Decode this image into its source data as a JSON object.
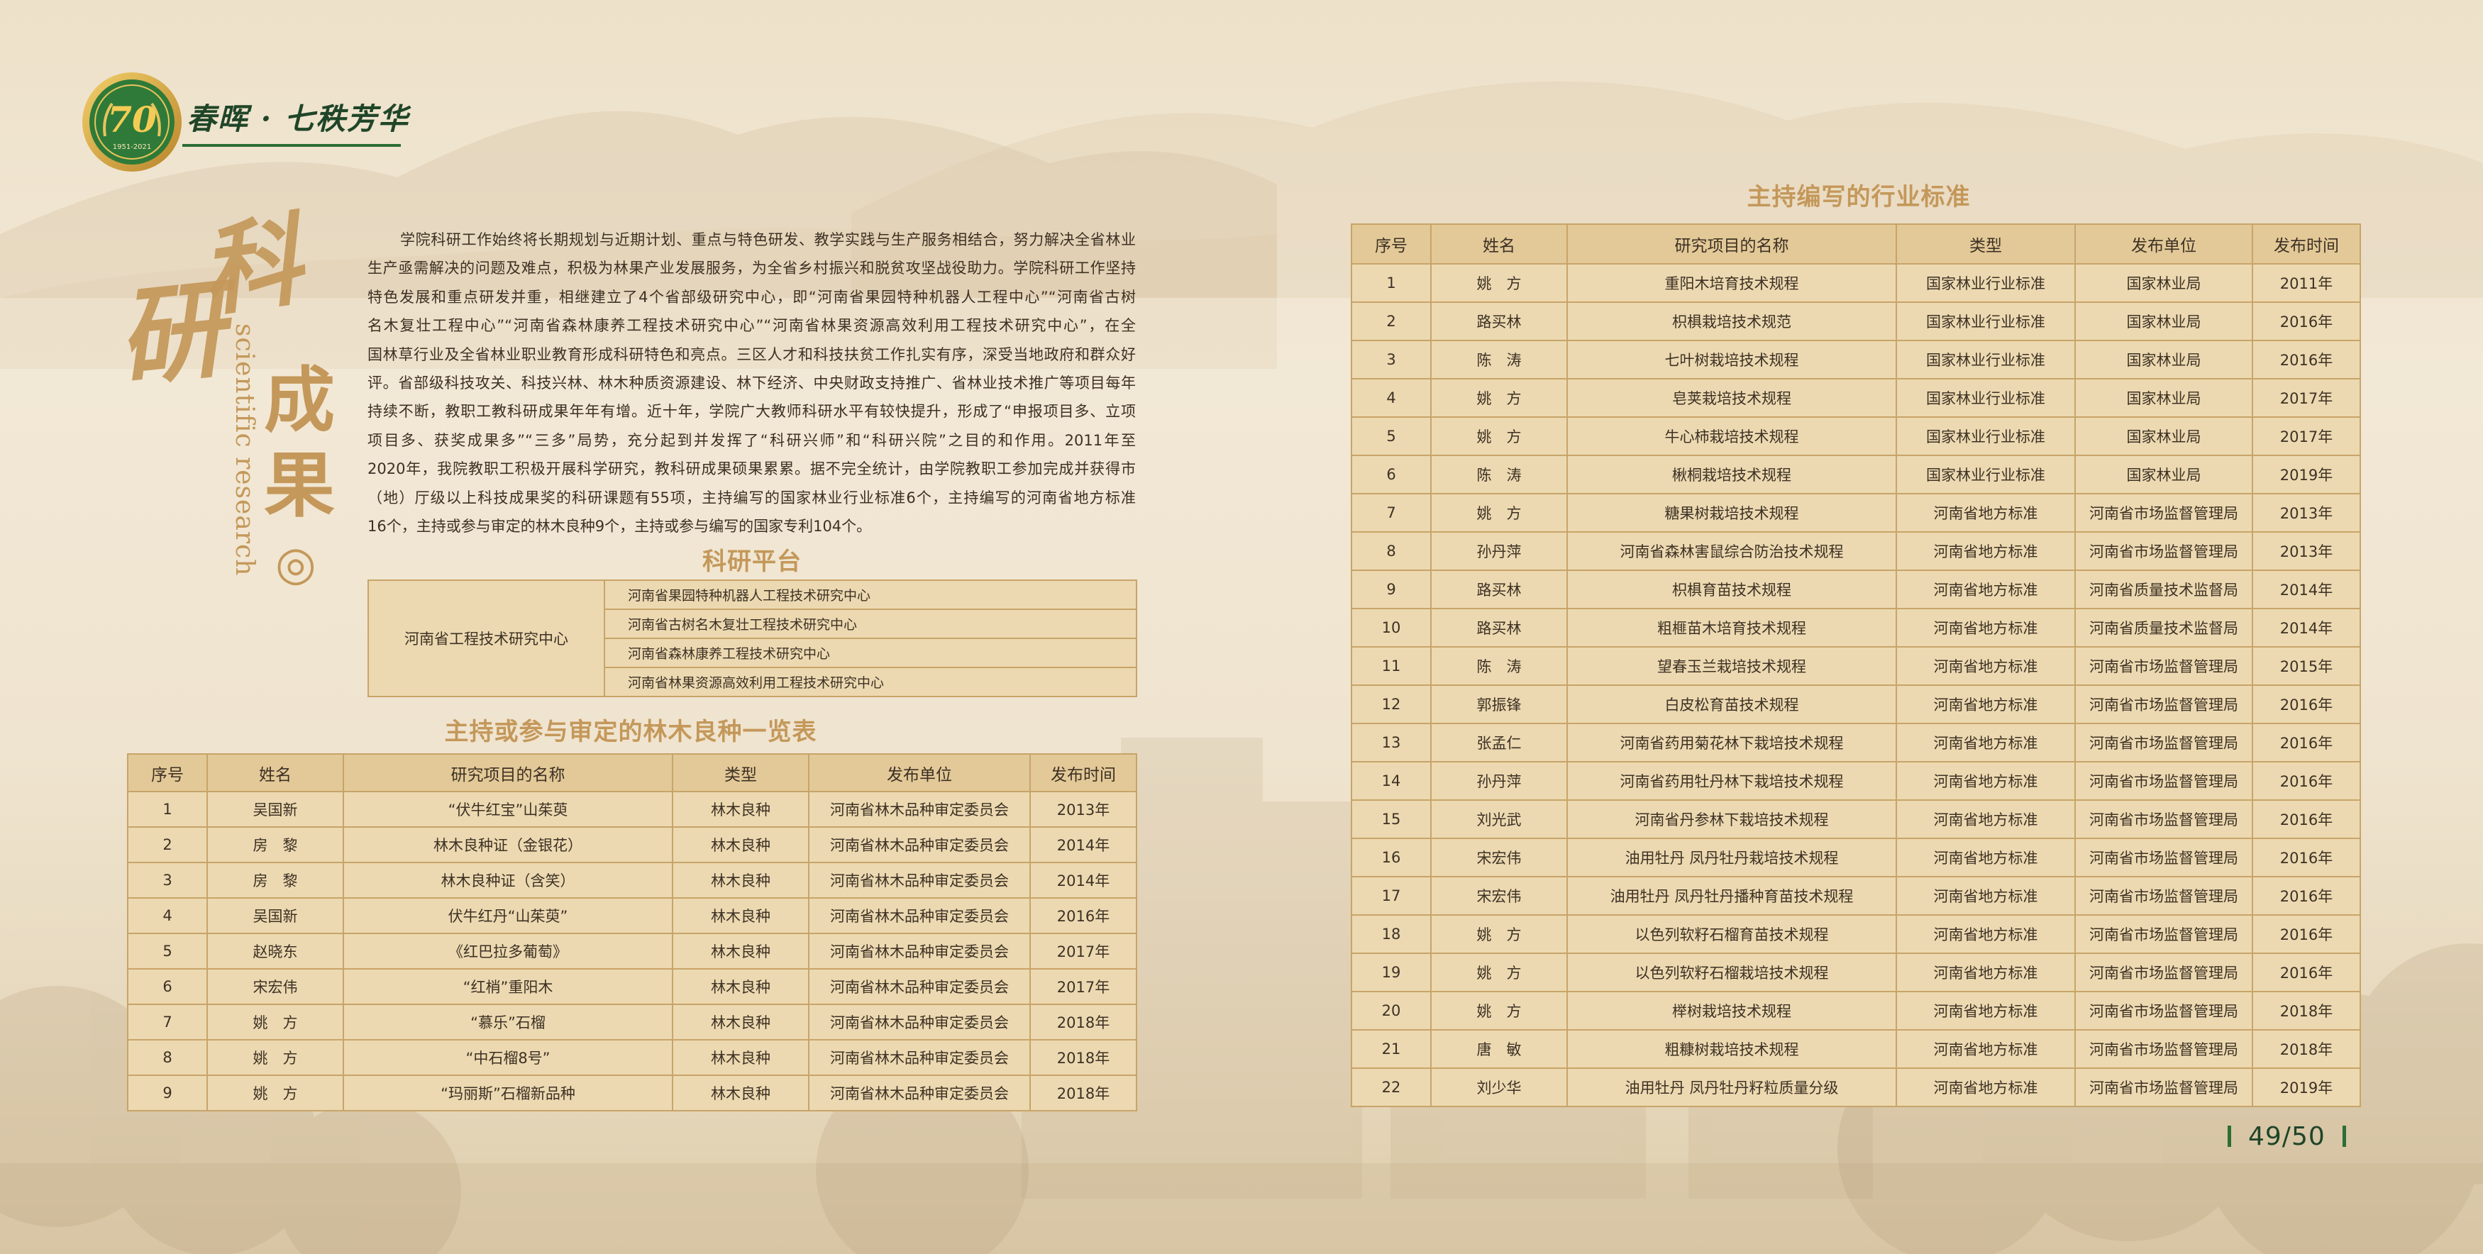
{
  "header": {
    "logo_number": "70",
    "logo_years": "1951-2021",
    "title": "春晖 · 七秩芳华"
  },
  "section": {
    "chars": [
      "科",
      "研",
      "成",
      "果"
    ],
    "subtitle": "scientific research",
    "mark": "◎"
  },
  "intro": {
    "lines": [
      "学院科研工作始终将长期规划与近期计划、重点与特色研发、教学实践与生产服务相结合，努力解决全省林业",
      "生产亟需解决的问题及难点，积极为林果产业发展服务，为全省乡村振兴和脱贫攻坚战役助力。学院科研工作坚持",
      "特色发展和重点研发并重，相继建立了4个省部级研究中心，即“河南省果园特种机器人工程中心”“河南省古树",
      "名木复壮工程中心”“河南省森林康养工程技术研究中心”“河南省林果资源高效利用工程技术研究中心”，在全",
      "国林草行业及全省林业职业教育形成科研特色和亮点。三区人才和科技扶贫工作扎实有序，深受当地政府和群众好",
      "评。省部级科技攻关、科技兴林、林木种质资源建设、林下经济、中央财政支持推广、省林业技术推广等项目每年",
      "持续不断，教职工教科研成果年年有增。近十年，学院广大教师科研水平有较快提升，形成了“申报项目多、立项",
      "项目多、获奖成果多”“三多”局势，充分起到并发挥了“科研兴师”和“科研兴院”之目的和作用。2011年至",
      "2020年，我院教职工积极开展科学研究，教科研成果硕果累累。据不完全统计，由学院教职工参加完成并获得市",
      "（地）厅级以上科技成果奖的科研课题有55项，主持编写的国家林业行业标准6个，主持编写的河南省地方标准",
      "16个，主持或参与审定的林木良种9个，主持或参与编写的国家专利104个。"
    ]
  },
  "platform": {
    "title": "科研平台",
    "group": "河南省工程技术研究中心",
    "centers": [
      "河南省果园特种机器人工程技术研究中心",
      "河南省古树名木复壮工程技术研究中心",
      "河南省森林康养工程技术研究中心",
      "河南省林果资源高效利用工程技术研究中心"
    ]
  },
  "varieties": {
    "title": "主持或参与审定的林木良种一览表",
    "columns": [
      "序号",
      "姓名",
      "研究项目的名称",
      "类型",
      "发布单位",
      "发布时间"
    ],
    "rows": [
      [
        "1",
        "吴国新",
        "“伏牛红宝”山茱萸",
        "林木良种",
        "河南省林木品种审定委员会",
        "2013年"
      ],
      [
        "2",
        "房　黎",
        "林木良种证（金银花）",
        "林木良种",
        "河南省林木品种审定委员会",
        "2014年"
      ],
      [
        "3",
        "房　黎",
        "林木良种证（含笑）",
        "林木良种",
        "河南省林木品种审定委员会",
        "2014年"
      ],
      [
        "4",
        "吴国新",
        "伏牛红丹“山茱萸”",
        "林木良种",
        "河南省林木品种审定委员会",
        "2016年"
      ],
      [
        "5",
        "赵晓东",
        "《红巴拉多葡萄》",
        "林木良种",
        "河南省林木品种审定委员会",
        "2017年"
      ],
      [
        "6",
        "宋宏伟",
        "“红梢”重阳木",
        "林木良种",
        "河南省林木品种审定委员会",
        "2017年"
      ],
      [
        "7",
        "姚　方",
        "“慕乐”石榴",
        "林木良种",
        "河南省林木品种审定委员会",
        "2018年"
      ],
      [
        "8",
        "姚　方",
        "“中石榴8号”",
        "林木良种",
        "河南省林木品种审定委员会",
        "2018年"
      ],
      [
        "9",
        "姚　方",
        "“玛丽斯”石榴新品种",
        "林木良种",
        "河南省林木品种审定委员会",
        "2018年"
      ]
    ]
  },
  "standards": {
    "title": "主持编写的行业标准",
    "columns": [
      "序号",
      "姓名",
      "研究项目的名称",
      "类型",
      "发布单位",
      "发布时间"
    ],
    "rows": [
      [
        "1",
        "姚　方",
        "重阳木培育技术规程",
        "国家林业行业标准",
        "国家林业局",
        "2011年"
      ],
      [
        "2",
        "路买林",
        "枳椇栽培技术规范",
        "国家林业行业标准",
        "国家林业局",
        "2016年"
      ],
      [
        "3",
        "陈　涛",
        "七叶树栽培技术规程",
        "国家林业行业标准",
        "国家林业局",
        "2016年"
      ],
      [
        "4",
        "姚　方",
        "皂荚栽培技术规程",
        "国家林业行业标准",
        "国家林业局",
        "2017年"
      ],
      [
        "5",
        "姚　方",
        "牛心柿栽培技术规程",
        "国家林业行业标准",
        "国家林业局",
        "2017年"
      ],
      [
        "6",
        "陈　涛",
        "楸桐栽培技术规程",
        "国家林业行业标准",
        "国家林业局",
        "2019年"
      ],
      [
        "7",
        "姚　方",
        "糖果树栽培技术规程",
        "河南省地方标准",
        "河南省市场监督管理局",
        "2013年"
      ],
      [
        "8",
        "孙丹萍",
        "河南省森林害鼠综合防治技术规程",
        "河南省地方标准",
        "河南省市场监督管理局",
        "2013年"
      ],
      [
        "9",
        "路买林",
        "枳椇育苗技术规程",
        "河南省地方标准",
        "河南省质量技术监督局",
        "2014年"
      ],
      [
        "10",
        "路买林",
        "粗榧苗木培育技术规程",
        "河南省地方标准",
        "河南省质量技术监督局",
        "2014年"
      ],
      [
        "11",
        "陈　涛",
        "望春玉兰栽培技术规程",
        "河南省地方标准",
        "河南省市场监督管理局",
        "2015年"
      ],
      [
        "12",
        "郭振锋",
        "白皮松育苗技术规程",
        "河南省地方标准",
        "河南省市场监督管理局",
        "2016年"
      ],
      [
        "13",
        "张孟仁",
        "河南省药用菊花林下栽培技术规程",
        "河南省地方标准",
        "河南省市场监督管理局",
        "2016年"
      ],
      [
        "14",
        "孙丹萍",
        "河南省药用牡丹林下栽培技术规程",
        "河南省地方标准",
        "河南省市场监督管理局",
        "2016年"
      ],
      [
        "15",
        "刘光武",
        "河南省丹参林下栽培技术规程",
        "河南省地方标准",
        "河南省市场监督管理局",
        "2016年"
      ],
      [
        "16",
        "宋宏伟",
        "油用牡丹 凤丹牡丹栽培技术规程",
        "河南省地方标准",
        "河南省市场监督管理局",
        "2016年"
      ],
      [
        "17",
        "宋宏伟",
        "油用牡丹 凤丹牡丹播种育苗技术规程",
        "河南省地方标准",
        "河南省市场监督管理局",
        "2016年"
      ],
      [
        "18",
        "姚　方",
        "以色列软籽石榴育苗技术规程",
        "河南省地方标准",
        "河南省市场监督管理局",
        "2016年"
      ],
      [
        "19",
        "姚　方",
        "以色列软籽石榴栽培技术规程",
        "河南省地方标准",
        "河南省市场监督管理局",
        "2016年"
      ],
      [
        "20",
        "姚　方",
        "榉树栽培技术规程",
        "河南省地方标准",
        "河南省市场监督管理局",
        "2018年"
      ],
      [
        "21",
        "唐　敏",
        "粗糠树栽培技术规程",
        "河南省地方标准",
        "河南省市场监督管理局",
        "2018年"
      ],
      [
        "22",
        "刘少华",
        "油用牡丹 凤丹牡丹籽粒质量分级",
        "河南省地方标准",
        "河南省市场监督管理局",
        "2019年"
      ]
    ]
  },
  "page": {
    "number": "49/50"
  },
  "colors": {
    "gold": "#c4985a",
    "green": "#2c6e37",
    "dark_green": "#1f4528",
    "table_border": "#c8a469",
    "table_fill": "#ecd9b1",
    "header_fill": "#e3c998",
    "text": "#3d3124"
  }
}
